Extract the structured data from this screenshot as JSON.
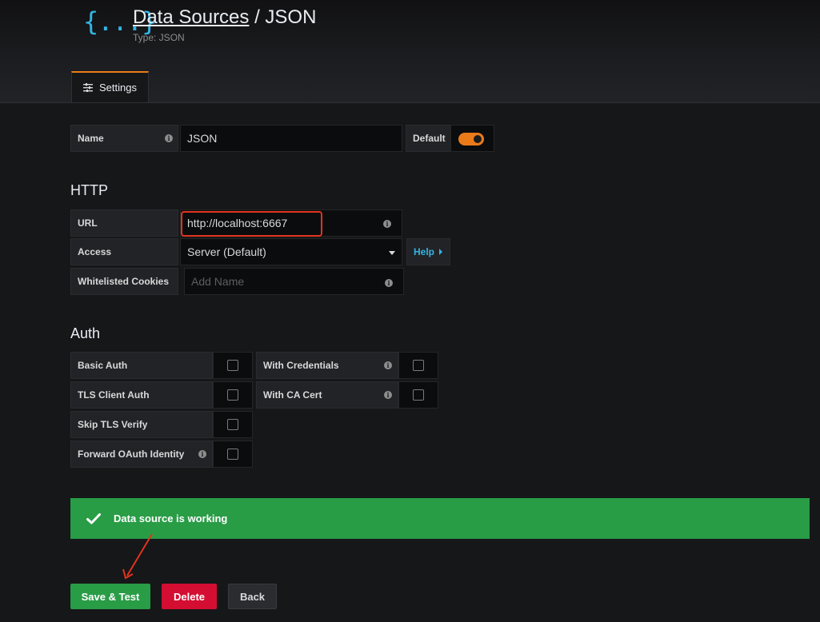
{
  "header": {
    "logo_text": "{...}",
    "title_link": "Data Sources",
    "title_separator": " / ",
    "title_name": "JSON",
    "subtitle": "Type: JSON"
  },
  "tabs": [
    {
      "label": "Settings",
      "icon": "sliders-icon",
      "active": true
    }
  ],
  "name_row": {
    "label": "Name",
    "value": "JSON",
    "default_label": "Default",
    "default_on": true
  },
  "http": {
    "title": "HTTP",
    "url_label": "URL",
    "url_value": "http://localhost:6667",
    "access_label": "Access",
    "access_value": "Server (Default)",
    "help_label": "Help",
    "cookies_label": "Whitelisted Cookies",
    "cookies_placeholder": "Add Name"
  },
  "auth": {
    "title": "Auth",
    "basic_auth": "Basic Auth",
    "tls_client_auth": "TLS Client Auth",
    "skip_tls_verify": "Skip TLS Verify",
    "forward_oauth": "Forward OAuth Identity",
    "with_credentials": "With Credentials",
    "with_ca_cert": "With CA Cert"
  },
  "alert": {
    "message": "Data source is working",
    "icon": "checkmark-icon"
  },
  "buttons": {
    "save_test": "Save & Test",
    "delete": "Delete",
    "back": "Back"
  },
  "colors": {
    "accent_orange": "#eb7b18",
    "link_blue": "#33b5e5",
    "success_green": "#299c46",
    "danger_red": "#d30e32",
    "annotation_red": "#e0341e"
  }
}
